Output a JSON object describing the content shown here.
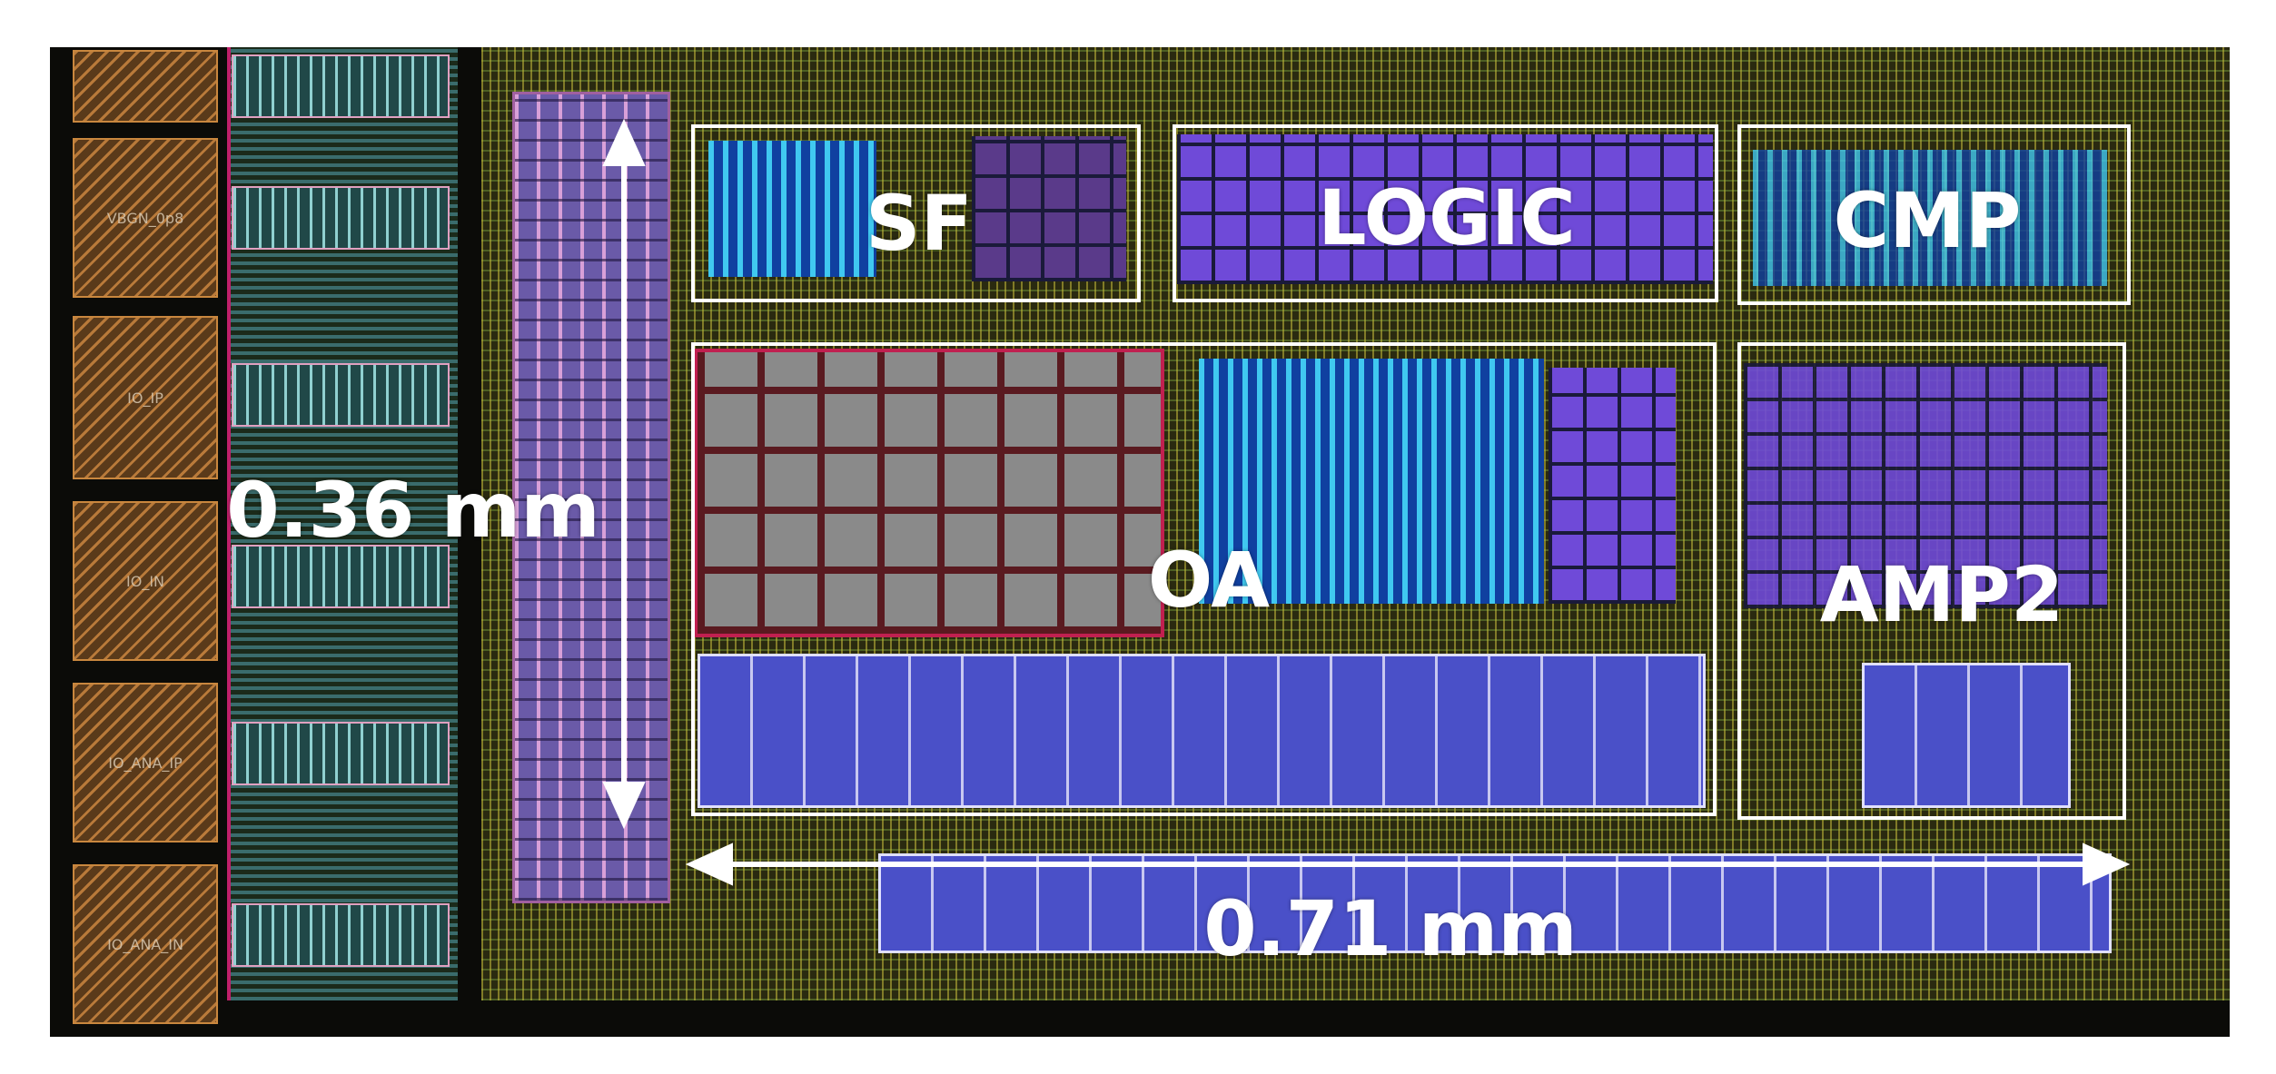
{
  "pads": [
    "",
    "VBGN_0p8",
    "IO_IP",
    "IO_IN",
    "IO_ANA_IP",
    "IO_ANA_IN"
  ],
  "blocks": {
    "sf": "SF",
    "logic": "LOGIC",
    "cmp": "CMP",
    "oa": "OA",
    "amp2": "AMP2"
  },
  "dimensions": {
    "height": "0.36 mm",
    "width": "0.71 mm"
  },
  "colors": {
    "annotation": "#ffffff",
    "pad": "#b97a3a",
    "core_fill": "#c8be3c"
  }
}
